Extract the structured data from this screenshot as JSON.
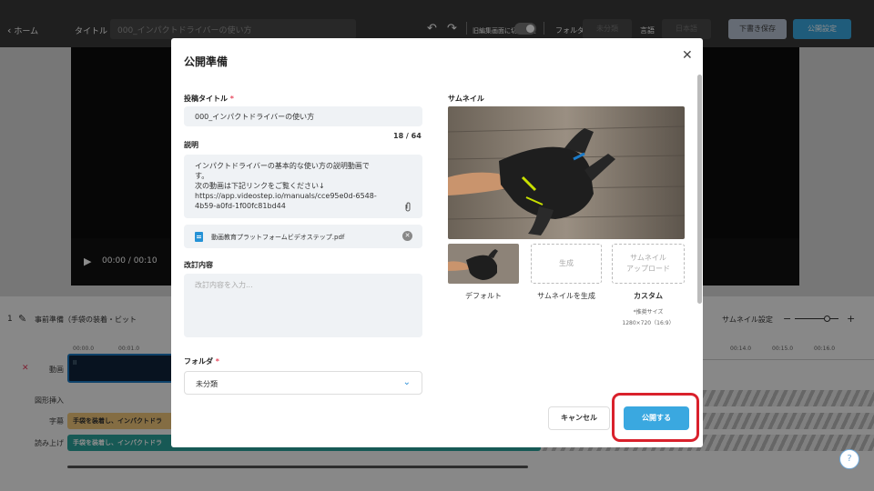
{
  "topbar": {
    "home": "ホーム",
    "title_label": "タイトル",
    "title_value": "000_インパクトドライバーの使い方",
    "old_editor_label": "旧編集画面に切り替え",
    "folder_label": "フォルダ",
    "folder_value": "未分類",
    "language_label": "言語",
    "language_value": "日本語",
    "save_draft": "下書き保存",
    "publish_settings": "公開設定"
  },
  "editor": {
    "time": "00:00 / 00:10",
    "scene_number": "1",
    "scene_name": "事前準備（手袋の装着・ビット",
    "thumbnail_setting": "サムネイル設定",
    "ruler_ticks_left": [
      "00:00.0",
      "00:01.0"
    ],
    "ruler_ticks_right": [
      "00:14.0",
      "00:15.0",
      "00:16.0"
    ],
    "tracks": {
      "video": "動画",
      "shape": "図形挿入",
      "subtitle": "字幕",
      "narration": "読み上げ"
    },
    "subtitle_clip": "手袋を装着し、インパクトドラ",
    "narration_clip": "手袋を装着し、インパクトドラ",
    "help": "?"
  },
  "modal": {
    "title": "公開準備",
    "post_title_label": "投稿タイトル",
    "required_mark": "*",
    "post_title_value": "000_インパクトドライバーの使い方",
    "title_counter": "18 / 64",
    "description_label": "説明",
    "description_lines": [
      "インパクトドライバーの基本的な使い方の説明動画で",
      "す。",
      "次の動画は下記リンクをご覧ください↓",
      "https://app.videostep.io/manuals/cce95e0d-6548-",
      "4b59-a0fd-1f00fc81bd44"
    ],
    "attachment_name": "動画教育プラットフォームビデオステップ.pdf",
    "revision_label": "改訂内容",
    "revision_placeholder": "改訂内容を入力...",
    "folder_label": "フォルダ",
    "folder_value": "未分類",
    "thumbnail_label": "サムネイル",
    "option_generate": "生成",
    "option_upload_line1": "サムネイル",
    "option_upload_line2": "アップロード",
    "caption_default": "デフォルト",
    "caption_generate": "サムネイルを生成",
    "caption_custom": "カスタム",
    "size_note_1": "*推奨サイズ",
    "size_note_2": "1280×720（16:9）",
    "cancel": "キャンセル",
    "publish": "公開する"
  },
  "colors": {
    "accent": "#3aa8e0",
    "highlight": "#d9212c",
    "required": "#e84a5f"
  }
}
